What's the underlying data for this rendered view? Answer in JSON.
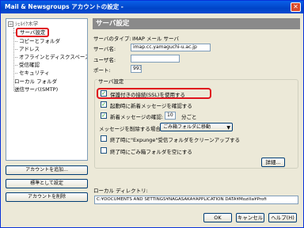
{
  "window": {
    "title": "Mail & Newsgroups アカウントの設定 -"
  },
  "tree": {
    "root_label": "ｼｪﾙｲｸ木学",
    "items": [
      {
        "label": "サーバ設定"
      },
      {
        "label": "コピーとフォルダ"
      },
      {
        "label": "アドレス"
      },
      {
        "label": "オフラインとディスクスペース"
      },
      {
        "label": "受信確認"
      },
      {
        "label": "セキュリティ"
      }
    ],
    "local_folders": "ローカル フォルダ",
    "outgoing_server": "送信サーバ(SMTP)"
  },
  "left_buttons": {
    "add_account": "アカウントを追加...",
    "set_default": "標準として設定",
    "delete_account": "アカウントを削除"
  },
  "panel": {
    "title": "サーバ設定",
    "server_type_label": "サーバのタイプ:",
    "server_type_value": "IMAP メール サーバ",
    "server_name_label": "サーバ名:",
    "server_name_value": "imap.cc.yamaguchi-u.ac.jp",
    "user_name_label": "ユーザ名:",
    "user_name_value": "",
    "port_label": "ポート:",
    "port_value": "993"
  },
  "server_settings": {
    "group_title": "サーバ設定",
    "use_ssl": "保護付きの接続(SSL)を使用する",
    "check_on_startup": "起動時に新着メッセージを確認する",
    "check_every_prefix": "新着メッセージの確認:",
    "check_every_value": "10",
    "check_every_suffix": "分ごと",
    "on_delete_label": "メッセージを削除する場合:",
    "on_delete_value": "ごみ箱フォルダに移動",
    "expunge_on_exit": "終了時に\"Expunge\"受信フォルダをクリーンアップする",
    "empty_trash_on_exit": "終了時にごみ箱フォルダを空にする",
    "advanced_button": "詳細..."
  },
  "local_dir": {
    "label": "ローカル ディレクトリ:",
    "path": "C:¥DOCUMENTS AND SETTINGS¥NAGASAKA¥APPLICATION DATA¥Mozilla¥Profi"
  },
  "dialog_buttons": {
    "ok": "OK",
    "cancel": "キャンセル",
    "help": "ヘルプ(H)"
  }
}
